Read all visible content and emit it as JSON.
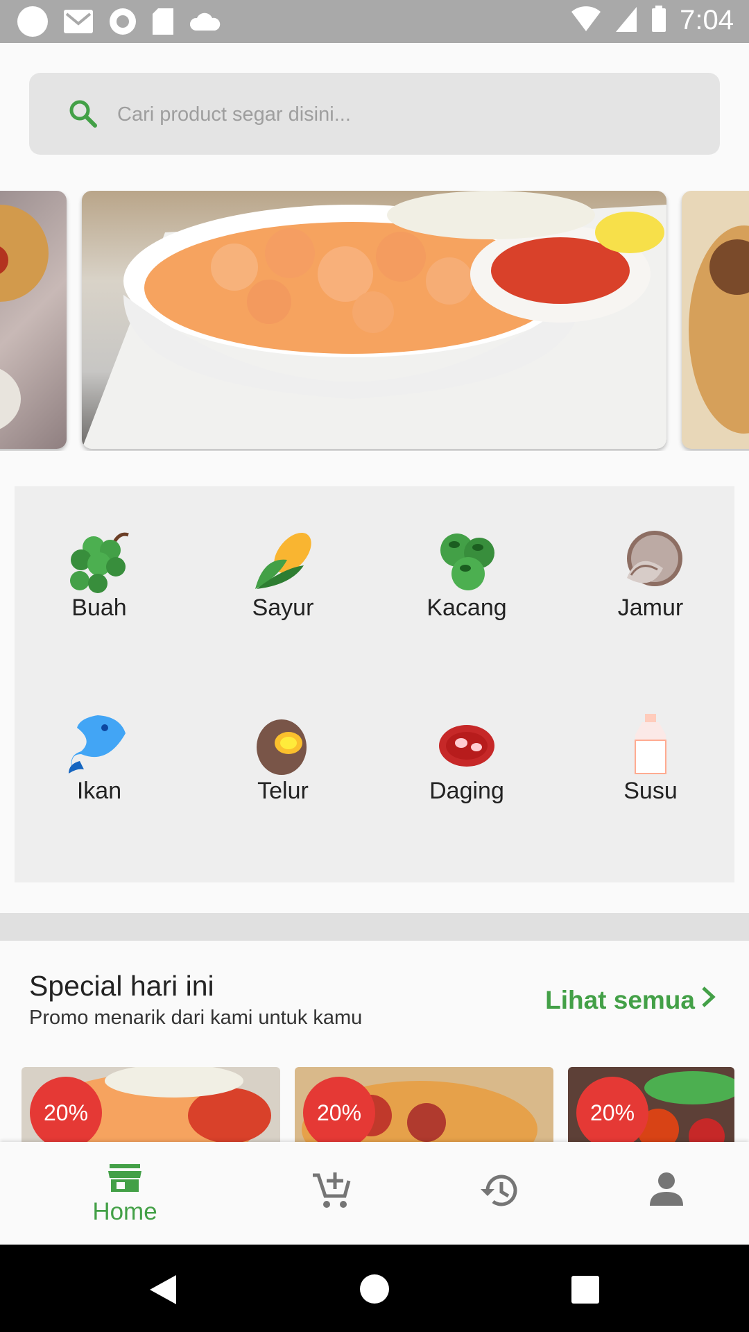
{
  "status_bar": {
    "time": "7:04"
  },
  "search": {
    "placeholder": "Cari product segar disini..."
  },
  "categories": [
    {
      "label": "Buah",
      "icon": "grapes-icon"
    },
    {
      "label": "Sayur",
      "icon": "corn-icon"
    },
    {
      "label": "Kacang",
      "icon": "beans-icon"
    },
    {
      "label": "Jamur",
      "icon": "mushroom-icon"
    },
    {
      "label": "Ikan",
      "icon": "fish-icon"
    },
    {
      "label": "Telur",
      "icon": "egg-icon"
    },
    {
      "label": "Daging",
      "icon": "meat-icon"
    },
    {
      "label": "Susu",
      "icon": "milk-icon"
    }
  ],
  "special": {
    "title": "Special hari ini",
    "subtitle": "Promo menarik dari kami untuk kamu",
    "see_all": "Lihat semua"
  },
  "promos": [
    {
      "discount": "20%"
    },
    {
      "discount": "20%"
    },
    {
      "discount": "20%"
    }
  ],
  "bottom_nav": {
    "home_label": "Home"
  },
  "colors": {
    "accent": "#43a047",
    "badge": "#e53935",
    "status_bar": "#a9a9a9"
  }
}
